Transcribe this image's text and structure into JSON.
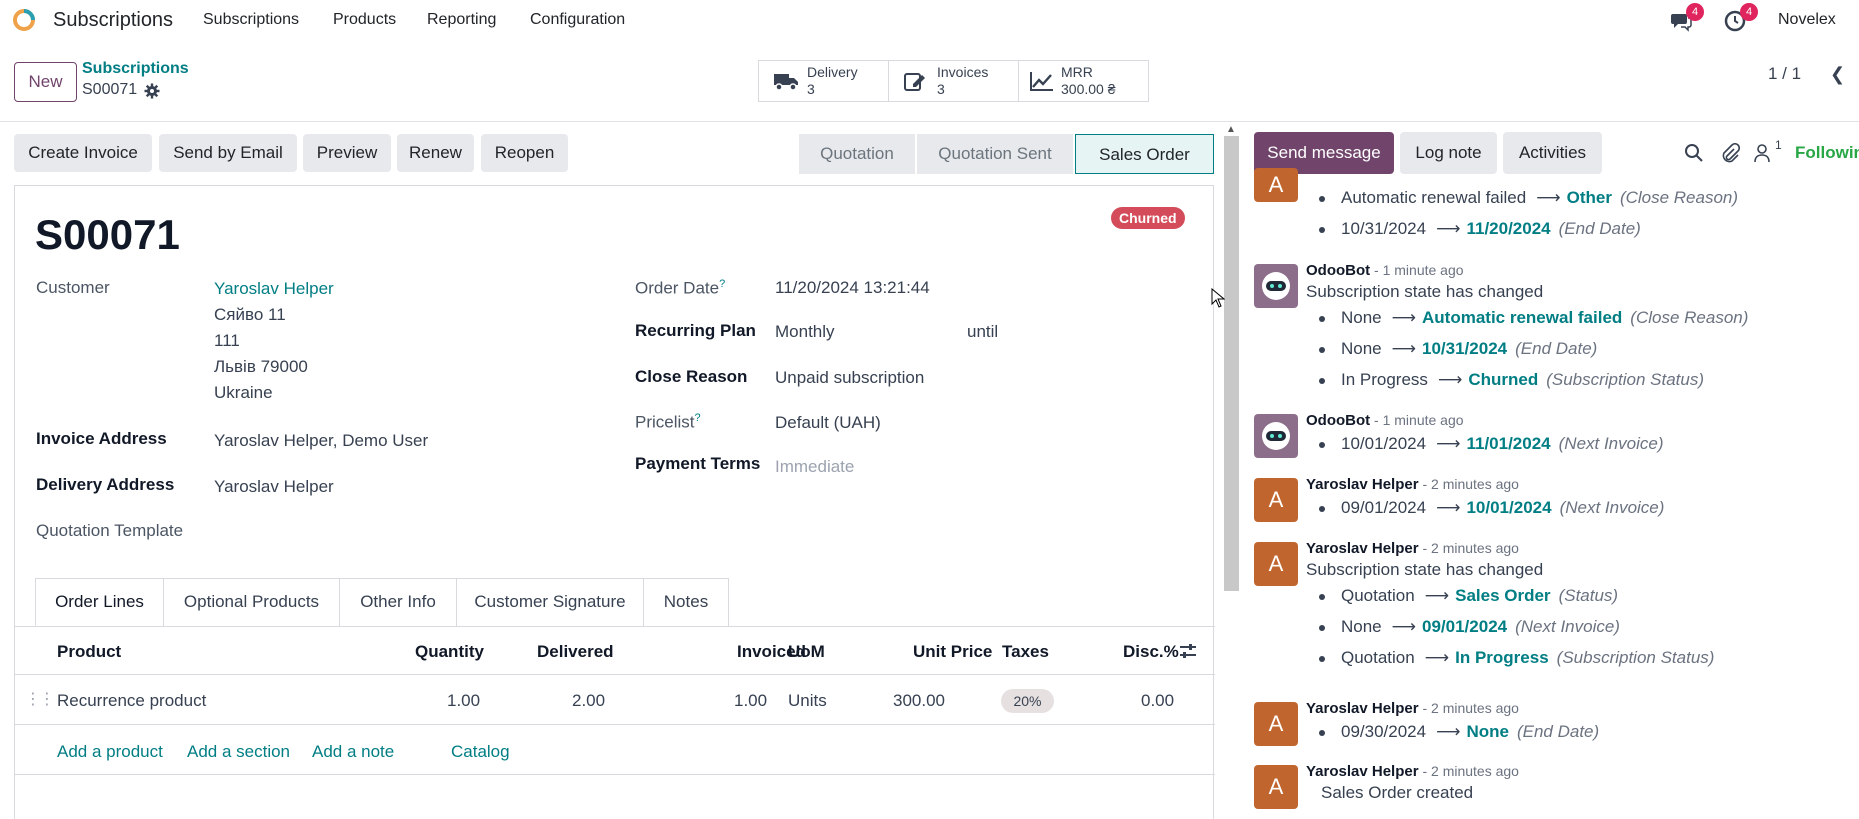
{
  "navbar": {
    "app_name": "Subscriptions",
    "menus": [
      "Subscriptions",
      "Products",
      "Reporting",
      "Configuration"
    ],
    "messages_count": "4",
    "activities_count": "4",
    "company": "Novelex"
  },
  "control": {
    "new_label": "New",
    "breadcrumb_parent": "Subscriptions",
    "breadcrumb_current": "S00071",
    "smart_buttons": [
      {
        "label": "Delivery",
        "value": "3",
        "icon": "truck-icon"
      },
      {
        "label": "Invoices",
        "value": "3",
        "icon": "edit-invoice-icon"
      },
      {
        "label": "MRR",
        "value": "300.00 ₴",
        "icon": "chart-line-icon"
      }
    ],
    "pager": "1 / 1"
  },
  "actions": [
    "Create Invoice",
    "Send by Email",
    "Preview",
    "Renew",
    "Reopen"
  ],
  "stages": [
    "Quotation",
    "Quotation Sent",
    "Sales Order"
  ],
  "active_stage": "Sales Order",
  "form": {
    "name": "S00071",
    "status_badge": "Churned",
    "customer_label": "Customer",
    "customer_name": "Yaroslav Helper",
    "customer_address": [
      "Сяйво 11",
      "111",
      "Львів 79000",
      "Ukraine"
    ],
    "invoice_address_label": "Invoice Address",
    "invoice_address": "Yaroslav Helper, Demo User",
    "delivery_address_label": "Delivery Address",
    "delivery_address": "Yaroslav Helper",
    "quotation_template_label": "Quotation Template",
    "order_date_label": "Order Date",
    "order_date": "11/20/2024 13:21:44",
    "recurring_plan_label": "Recurring Plan",
    "recurring_plan": "Monthly",
    "until_label": "until",
    "close_reason_label": "Close Reason",
    "close_reason": "Unpaid subscription",
    "pricelist_label": "Pricelist",
    "pricelist": "Default (UAH)",
    "payment_terms_label": "Payment Terms",
    "payment_terms": "Immediate",
    "help_mark": "?"
  },
  "tabs": [
    "Order Lines",
    "Optional Products",
    "Other Info",
    "Customer Signature",
    "Notes"
  ],
  "table": {
    "headers": [
      "Product",
      "Quantity",
      "Delivered",
      "Invoiced",
      "UoM",
      "Unit Price",
      "Taxes",
      "Disc.%"
    ],
    "rows": [
      {
        "product": "Recurrence product",
        "quantity": "1.00",
        "delivered": "2.00",
        "invoiced": "1.00",
        "uom": "Units",
        "unit_price": "300.00",
        "taxes": "20%",
        "disc": "0.00"
      }
    ],
    "add_links": [
      "Add a product",
      "Add a section",
      "Add a note",
      "Catalog"
    ]
  },
  "chatter": {
    "send_message": "Send message",
    "log_note": "Log note",
    "activities": "Activities",
    "followers_count": "1",
    "following": "Following",
    "messages": [
      {
        "author": "",
        "ago": "",
        "text": "",
        "avatar": "A",
        "changes": [
          {
            "old": "Automatic renewal failed",
            "new": "Other",
            "field": "(Close Reason)"
          },
          {
            "old": "10/31/2024",
            "new": "11/20/2024",
            "field": "(End Date)"
          }
        ]
      },
      {
        "author": "OdooBot",
        "ago": "- 1 minute ago",
        "text": "Subscription state has changed",
        "avatar": "bot",
        "changes": [
          {
            "old": "None",
            "new": "Automatic renewal failed",
            "field": "(Close Reason)"
          },
          {
            "old": "None",
            "new": "10/31/2024",
            "field": "(End Date)"
          },
          {
            "old": "In Progress",
            "new": "Churned",
            "field": "(Subscription Status)"
          }
        ]
      },
      {
        "author": "OdooBot",
        "ago": "- 1 minute ago",
        "text": "",
        "avatar": "bot",
        "changes": [
          {
            "old": "10/01/2024",
            "new": "11/01/2024",
            "field": "(Next Invoice)"
          }
        ]
      },
      {
        "author": "Yaroslav Helper",
        "ago": "- 2 minutes ago",
        "text": "",
        "avatar": "A",
        "changes": [
          {
            "old": "09/01/2024",
            "new": "10/01/2024",
            "field": "(Next Invoice)"
          }
        ]
      },
      {
        "author": "Yaroslav Helper",
        "ago": "- 2 minutes ago",
        "text": "Subscription state has changed",
        "avatar": "A",
        "changes": [
          {
            "old": "Quotation",
            "new": "Sales Order",
            "field": "(Status)"
          },
          {
            "old": "None",
            "new": "09/01/2024",
            "field": "(Next Invoice)"
          },
          {
            "old": "Quotation",
            "new": "In Progress",
            "field": "(Subscription Status)"
          }
        ]
      },
      {
        "author": "Yaroslav Helper",
        "ago": "- 2 minutes ago",
        "text": "",
        "avatar": "A",
        "changes": [
          {
            "old": "09/30/2024",
            "new": "None",
            "field": "(End Date)"
          }
        ]
      },
      {
        "author": "Yaroslav Helper",
        "ago": "- 2 minutes ago",
        "text": "Sales Order created",
        "avatar": "A",
        "changes": []
      }
    ]
  },
  "colors": {
    "brand": "#71446b",
    "link": "#017e84",
    "danger": "#d44c59",
    "avatar_orange": "#c0652d"
  }
}
